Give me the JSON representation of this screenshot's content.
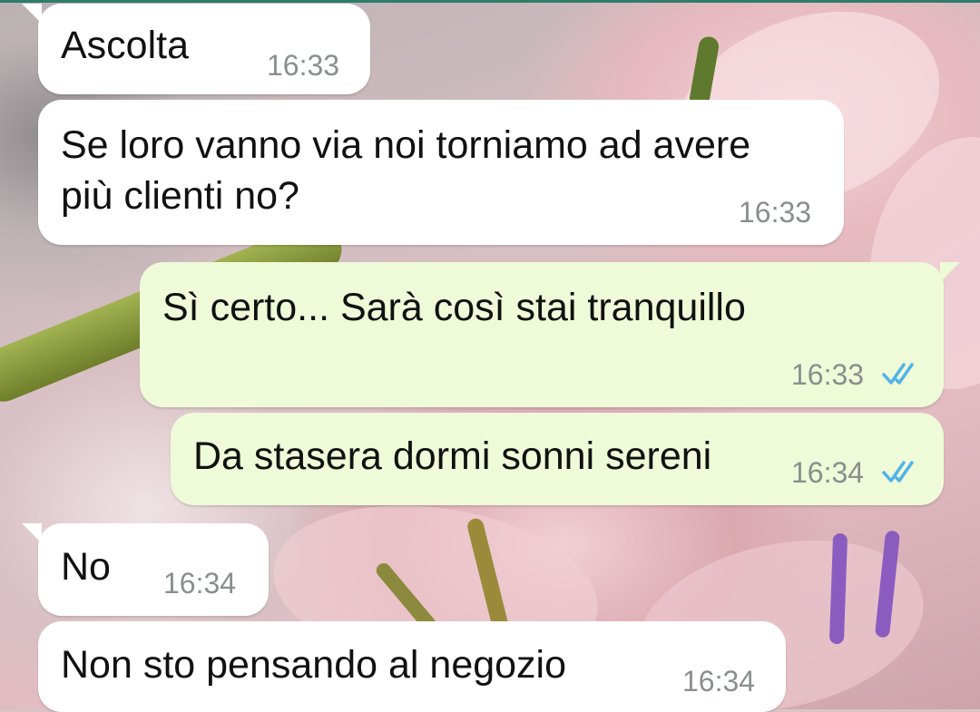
{
  "messages": [
    {
      "direction": "incoming",
      "text": "Ascolta",
      "time": "16:33"
    },
    {
      "direction": "incoming",
      "text_lines": [
        "Se loro vanno via noi torniamo ad avere",
        "più clienti no?"
      ],
      "time": "16:33"
    },
    {
      "direction": "outgoing",
      "text": "Sì certo... Sarà così stai tranquillo",
      "time": "16:33",
      "status": "read",
      "status_icon": "double-check-icon"
    },
    {
      "direction": "outgoing",
      "text": "Da stasera dormi sonni sereni",
      "time": "16:34",
      "status": "read",
      "status_icon": "double-check-icon"
    },
    {
      "direction": "incoming",
      "text": "No",
      "time": "16:34"
    },
    {
      "direction": "incoming",
      "text": "Non sto pensando al negozio",
      "time": "16:34"
    }
  ],
  "colors": {
    "incoming_bubble": "#ffffff",
    "outgoing_bubble": "#eefad8",
    "read_ticks": "#4fb3e8",
    "timestamp": "#8a8f8c",
    "annotation_marker": "#8a5cc0"
  }
}
